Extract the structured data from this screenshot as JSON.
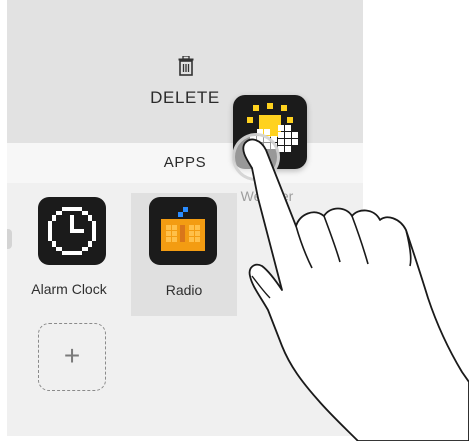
{
  "delete_zone": {
    "label": "DELETE",
    "icon": "trash-icon"
  },
  "apps_header": {
    "label": "APPS"
  },
  "apps": [
    {
      "name": "Alarm Clock",
      "icon": "alarm-clock-icon",
      "selected": false
    },
    {
      "name": "Radio",
      "icon": "radio-icon",
      "selected": true
    }
  ],
  "add_slot": {
    "label": "+",
    "icon": "plus-icon"
  },
  "dragging_app": {
    "name": "Weather",
    "icon": "weather-icon"
  },
  "colors": {
    "delete_zone_bg": "#e2e2e2",
    "apps_bar_bg": "#f7f7f7",
    "panel_bg": "#f0f0f0",
    "selected_tile_bg": "#e0e0e0",
    "icon_bg": "#1b1b1b",
    "radio_orange": "#f39c12",
    "radio_blue": "#2a8cff",
    "weather_yellow": "#ffd21f"
  }
}
